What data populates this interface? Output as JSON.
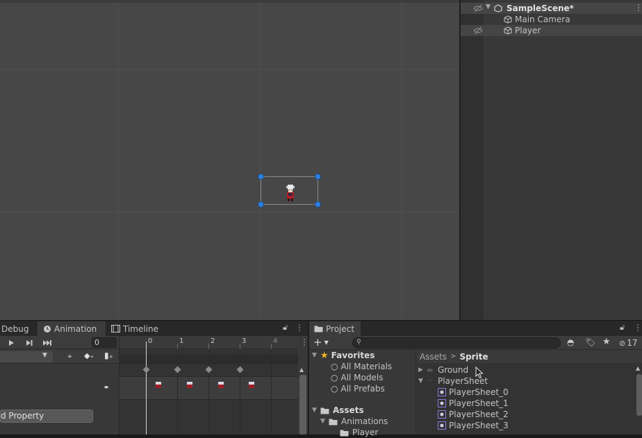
{
  "hierarchy": {
    "scene_name": "SampleScene*",
    "items": [
      {
        "label": "Main Camera"
      },
      {
        "label": "Player"
      }
    ]
  },
  "animation": {
    "tabs": [
      {
        "label": "Debug"
      },
      {
        "label": "Animation"
      },
      {
        "label": "Timeline"
      }
    ],
    "frame_value": "0",
    "ruler_ticks": [
      "0",
      "1",
      "2",
      "3",
      "4"
    ],
    "add_property_label": "d Property"
  },
  "project": {
    "tab_label": "Project",
    "search_placeholder": "",
    "badge_count": "17",
    "favorites": {
      "label": "Favorites",
      "items": [
        "All Materials",
        "All Models",
        "All Prefabs"
      ]
    },
    "assets": {
      "label": "Assets",
      "children": [
        "Animations",
        "Player"
      ]
    },
    "breadcrumb": [
      "Assets",
      "Sprite"
    ],
    "files": [
      {
        "label": "Ground"
      },
      {
        "label": "PlayerSheet"
      },
      {
        "label": "PlayerSheet_0"
      },
      {
        "label": "PlayerSheet_1"
      },
      {
        "label": "PlayerSheet_2"
      },
      {
        "label": "PlayerSheet_3"
      }
    ]
  },
  "colors": {
    "selection_handle": "#2f7fe0",
    "accent_star": "#f0b429"
  }
}
